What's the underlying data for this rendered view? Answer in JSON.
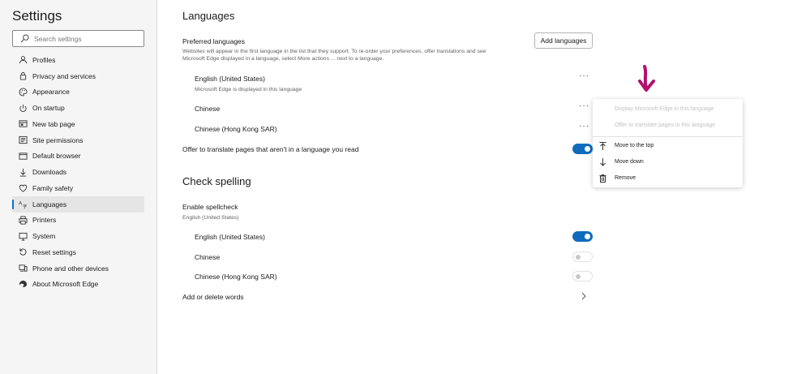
{
  "sidebar": {
    "title": "Settings",
    "search_placeholder": "Search settings",
    "items": [
      {
        "label": "Profiles",
        "icon": "profile-icon"
      },
      {
        "label": "Privacy and services",
        "icon": "lock-icon"
      },
      {
        "label": "Appearance",
        "icon": "palette-icon"
      },
      {
        "label": "On startup",
        "icon": "power-icon"
      },
      {
        "label": "New tab page",
        "icon": "new-tab-icon"
      },
      {
        "label": "Site permissions",
        "icon": "site-permissions-icon"
      },
      {
        "label": "Default browser",
        "icon": "browser-icon"
      },
      {
        "label": "Downloads",
        "icon": "download-icon"
      },
      {
        "label": "Family safety",
        "icon": "family-icon"
      },
      {
        "label": "Languages",
        "icon": "languages-icon",
        "active": true
      },
      {
        "label": "Printers",
        "icon": "printer-icon"
      },
      {
        "label": "System",
        "icon": "system-icon"
      },
      {
        "label": "Reset settings",
        "icon": "reset-icon"
      },
      {
        "label": "Phone and other devices",
        "icon": "phone-icon"
      },
      {
        "label": "About Microsoft Edge",
        "icon": "edge-icon"
      }
    ]
  },
  "languages": {
    "title": "Languages",
    "preferred_label": "Preferred languages",
    "preferred_desc_line1": "Websites will appear in the first language in the list that they support. To re-order your preferences, offer translations and see",
    "preferred_desc_line2": "Microsoft Edge displayed in a language, select More actions ... next to a language.",
    "add_button": "Add languages",
    "list": [
      {
        "name": "English (United States)",
        "note": "Microsoft Edge is displayed in this language"
      },
      {
        "name": "Chinese",
        "note": ""
      },
      {
        "name": "Chinese (Hong Kong SAR)",
        "note": ""
      }
    ],
    "more_actions": "···",
    "offer_translate_label": "Offer to translate pages that aren't in a language you read",
    "offer_translate_on": true
  },
  "spelling": {
    "title": "Check spelling",
    "enable_label": "Enable spellcheck",
    "enable_sub": "English (United States)",
    "languages": [
      {
        "name": "English (United States)",
        "on": true
      },
      {
        "name": "Chinese",
        "on": false
      },
      {
        "name": "Chinese (Hong Kong SAR)",
        "on": false
      }
    ],
    "add_delete_label": "Add or delete words"
  },
  "context_menu": {
    "items": [
      {
        "label": "Display Microsoft Edge in this language",
        "disabled": true
      },
      {
        "label": "Offer to translate pages in this language",
        "disabled": true
      },
      {
        "label": "Move to the top",
        "disabled": false,
        "icon": "move-to-top-icon"
      },
      {
        "label": "Move down",
        "disabled": false,
        "icon": "arrow-down-icon"
      },
      {
        "label": "Remove",
        "disabled": false,
        "icon": "trash-icon"
      }
    ]
  },
  "colors": {
    "accent": "#0f6cbd",
    "annotation_arrow": "#b0126e"
  }
}
